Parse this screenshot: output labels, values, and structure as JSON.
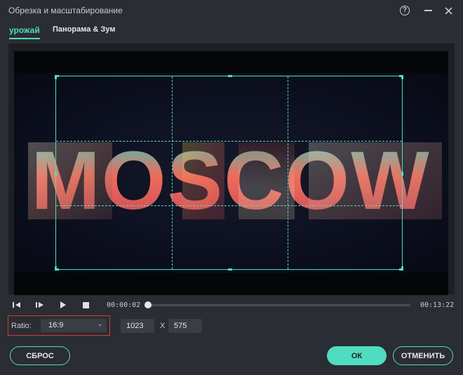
{
  "window": {
    "title": "Обрезка и масштабирование",
    "help_label": "?"
  },
  "tabs": [
    {
      "label": "урожай",
      "active": true
    },
    {
      "label": "Панорама & Зум",
      "active": false
    }
  ],
  "preview": {
    "text": "MOSCOW"
  },
  "playback": {
    "current_time": "00:00:02",
    "total_time": "00:13:22",
    "progress": 0.0025
  },
  "crop": {
    "ratio_label": "Ratio:",
    "ratio_value": "16:9",
    "width": "1023",
    "separator": "X",
    "height": "575"
  },
  "footer": {
    "reset_label": "СБРОС",
    "ok_label": "ОК",
    "cancel_label": "ОТМЕНИТЬ"
  },
  "colors": {
    "accent": "#4fdcc0",
    "highlight_border": "#d23b30",
    "background": "#2a2d33"
  },
  "icons": [
    "help-icon",
    "minimize-icon",
    "close-icon",
    "prev-frame-icon",
    "next-frame-icon",
    "play-icon",
    "stop-icon",
    "chevron-down-icon"
  ]
}
